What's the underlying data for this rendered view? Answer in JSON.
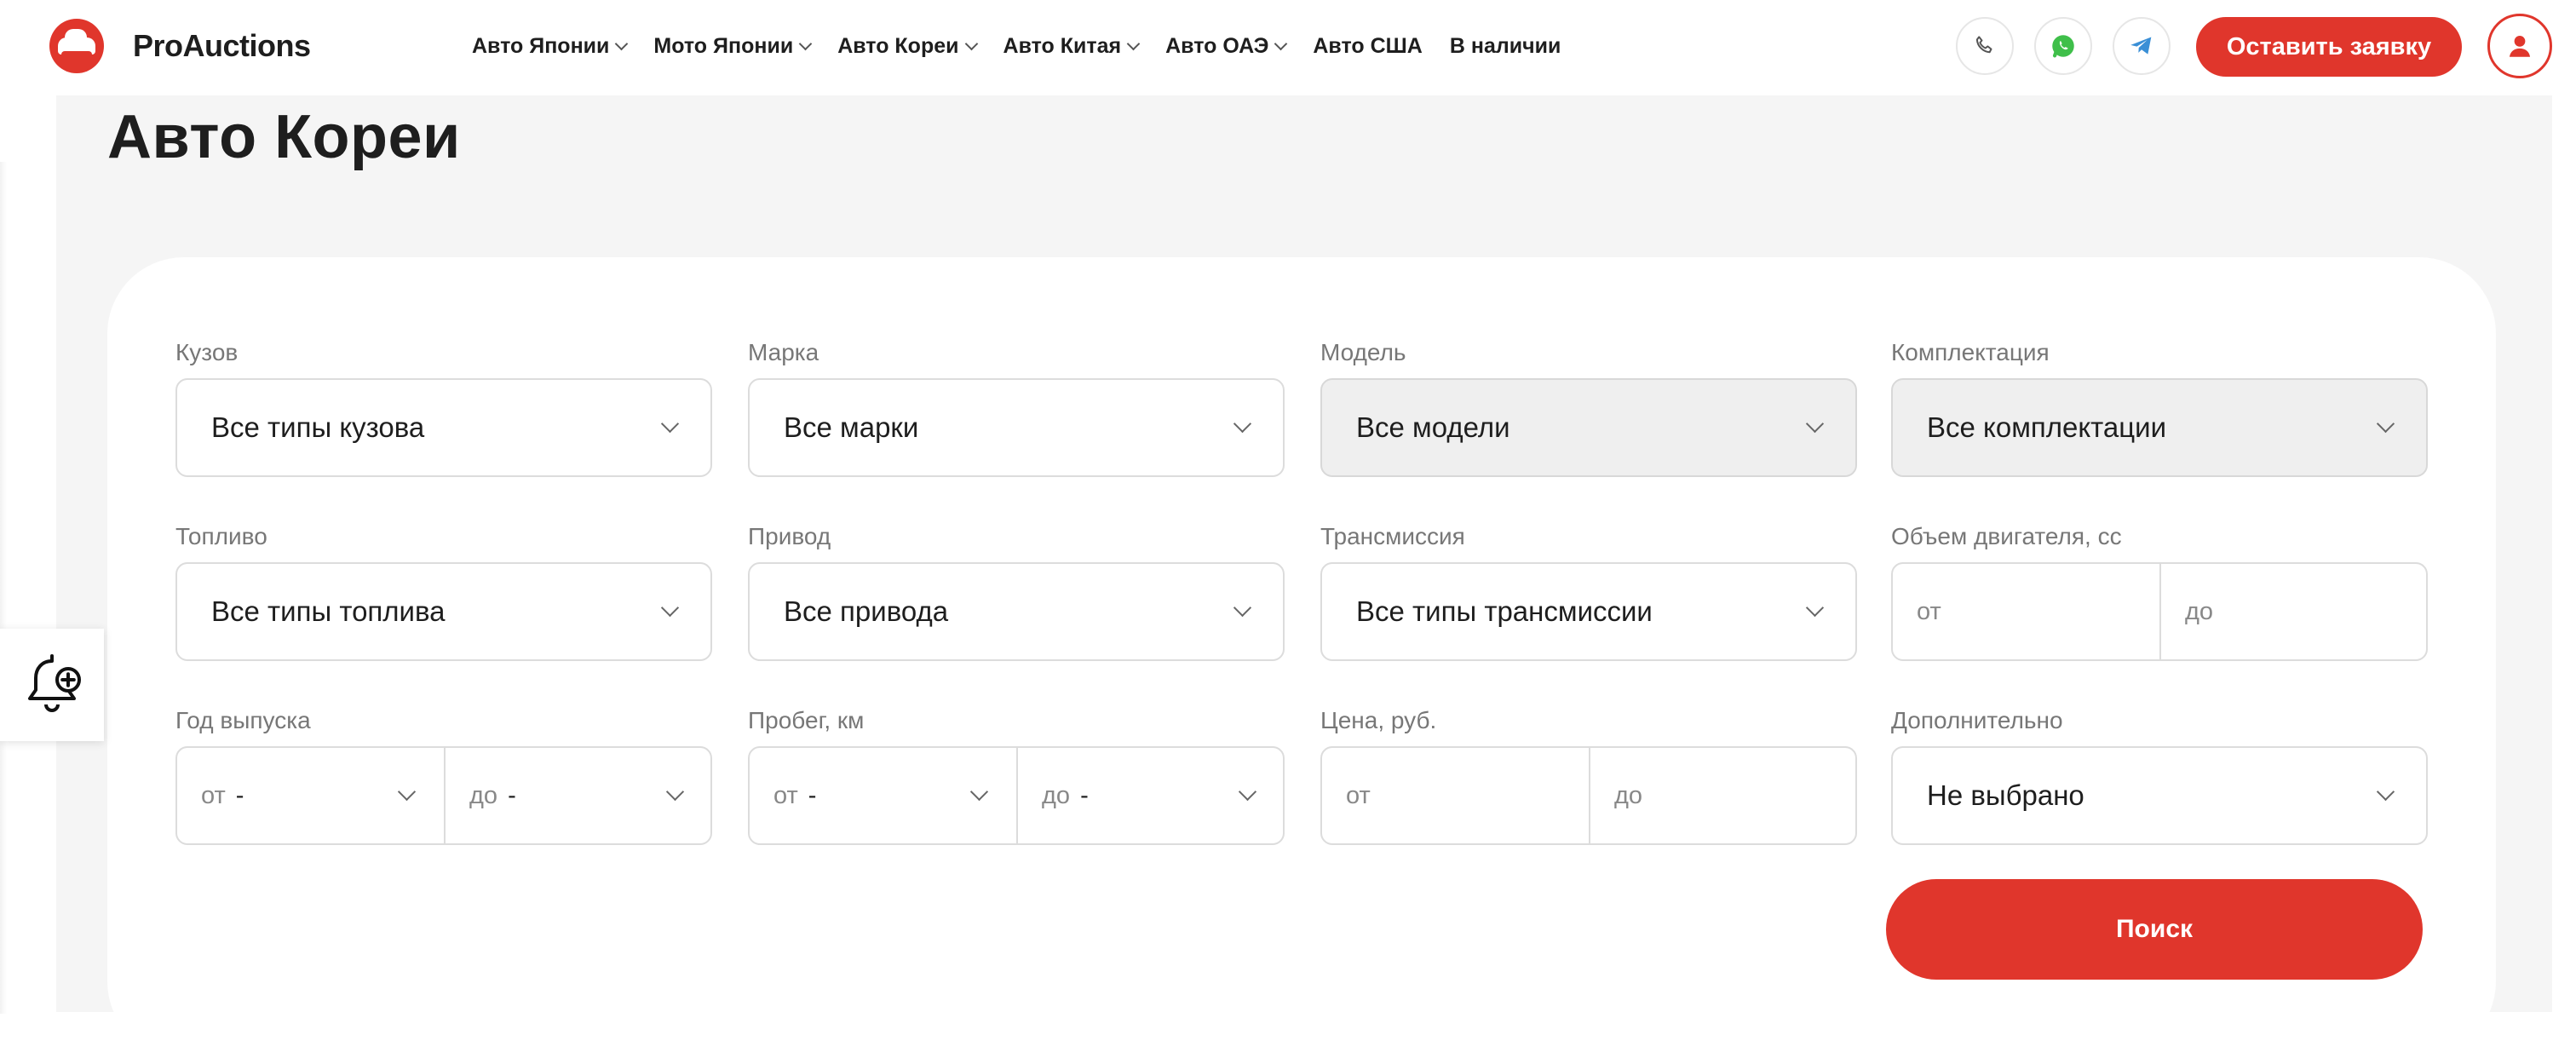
{
  "header": {
    "logo_text": "ProAuctions",
    "nav": [
      {
        "label": "Авто Японии",
        "has_dropdown": true
      },
      {
        "label": "Мото Японии",
        "has_dropdown": true
      },
      {
        "label": "Авто Кореи",
        "has_dropdown": true
      },
      {
        "label": "Авто Китая",
        "has_dropdown": true
      },
      {
        "label": "Авто ОАЭ",
        "has_dropdown": true
      },
      {
        "label": "Авто США",
        "has_dropdown": false
      },
      {
        "label": "В наличии",
        "has_dropdown": false
      }
    ],
    "contact_icons": [
      "phone-icon",
      "whatsapp-icon",
      "telegram-icon"
    ],
    "cta_label": "Оставить заявку",
    "profile_icon": "user-icon"
  },
  "page": {
    "title": "Авто Кореи"
  },
  "filters": {
    "body": {
      "label": "Кузов",
      "value": "Все типы кузова"
    },
    "brand": {
      "label": "Марка",
      "value": "Все марки"
    },
    "model": {
      "label": "Модель",
      "value": "Все модели",
      "disabled": true
    },
    "trim": {
      "label": "Комплектация",
      "value": "Все комплектации",
      "disabled": true
    },
    "fuel": {
      "label": "Топливо",
      "value": "Все типы топлива"
    },
    "drive": {
      "label": "Привод",
      "value": "Все привода"
    },
    "transmission": {
      "label": "Трансмиссия",
      "value": "Все типы трансмиссии"
    },
    "engine": {
      "label": "Объем двигателя, сс",
      "from_placeholder": "от",
      "to_placeholder": "до"
    },
    "year": {
      "label": "Год выпуска",
      "from_label": "от",
      "from_value": "-",
      "to_label": "до",
      "to_value": "-"
    },
    "mileage": {
      "label": "Пробег, км",
      "from_label": "от",
      "from_value": "-",
      "to_label": "до",
      "to_value": "-"
    },
    "price": {
      "label": "Цена, руб.",
      "from_placeholder": "от",
      "to_placeholder": "до"
    },
    "extra": {
      "label": "Дополнительно",
      "value": "Не выбрано"
    },
    "search_label": "Поиск"
  },
  "colors": {
    "accent": "#e0362c",
    "whatsapp": "#3fbf4a",
    "telegram": "#3a8fd6",
    "background": "#f5f5f5"
  }
}
